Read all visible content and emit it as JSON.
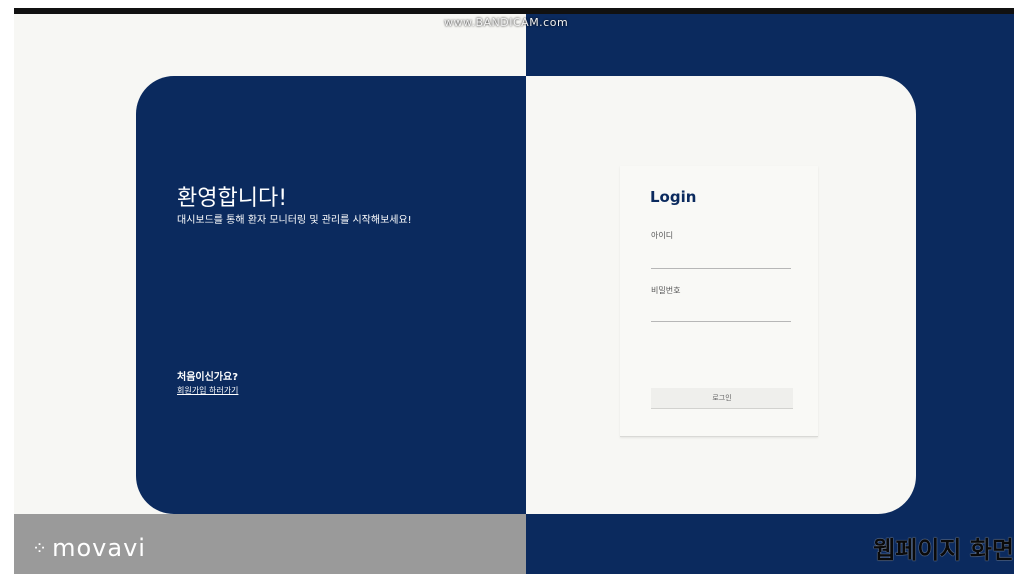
{
  "watermark_top": "www.BANDICAM.com",
  "welcome": {
    "title": "환영합니다!",
    "description": "대시보드를 통해 환자 모니터링 및 관리를 시작해보세요!"
  },
  "signup": {
    "question": "처음이신가요?",
    "link": "회원가입 하러가기"
  },
  "login": {
    "title": "Login",
    "id_label": "아이디",
    "id_value": "",
    "password_label": "비밀번호",
    "password_value": "",
    "button_label": "로그인"
  },
  "watermark_bottom": {
    "logo_text": "movavi",
    "caption": "웹페이지 화면"
  },
  "colors": {
    "navy": "#0b2a5e",
    "off_white": "#f7f7f4"
  }
}
